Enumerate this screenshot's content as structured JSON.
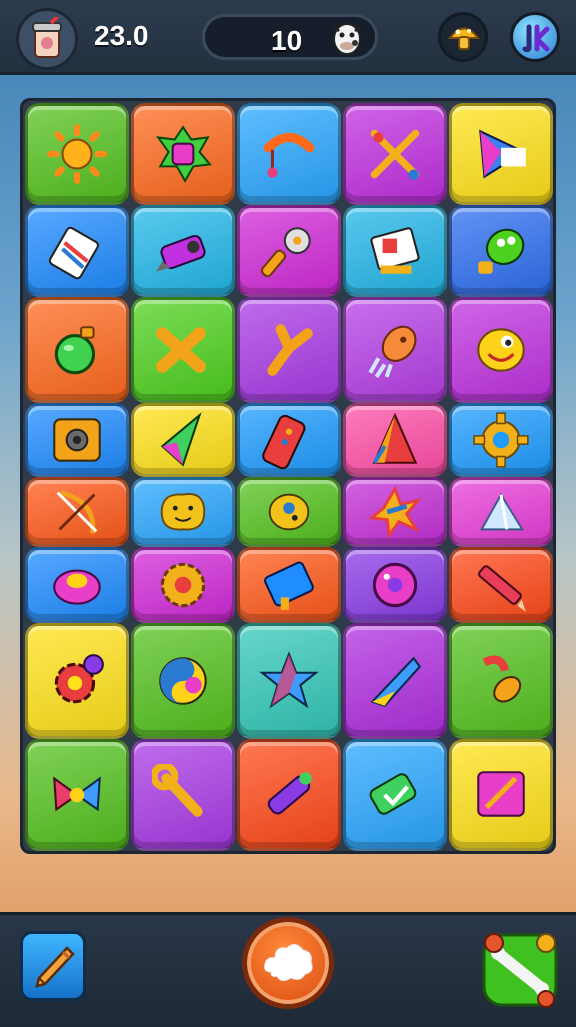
{
  "hud": {
    "score": "23.0",
    "counter": "10",
    "icons": [
      "cup-icon",
      "cow-icon",
      "mushroom-icon",
      "avatar-icon"
    ]
  },
  "board": {
    "rows": 8,
    "cols": 5,
    "tiles": [
      {
        "color": "#55c21f",
        "icon": "sun-icon"
      },
      {
        "color": "#ff6a1f",
        "icon": "flower-gem-icon"
      },
      {
        "color": "#2aa7ff",
        "icon": "hook-icon"
      },
      {
        "color": "#c02fe0",
        "icon": "crossed-swords-icon"
      },
      {
        "color": "#ffe21a",
        "icon": "play-triangle-icon"
      },
      {
        "color": "#1f8cff",
        "icon": "tablet-icon"
      },
      {
        "color": "#22b8e8",
        "icon": "flashlight-icon"
      },
      {
        "color": "#d12ad8",
        "icon": "pizza-cutter-icon"
      },
      {
        "color": "#23b6e8",
        "icon": "book-icon"
      },
      {
        "color": "#2f6ff0",
        "icon": "green-monster-icon"
      },
      {
        "color": "#ff6a1f",
        "icon": "bomb-icon"
      },
      {
        "color": "#4fd11f",
        "icon": "bone-cross-icon"
      },
      {
        "color": "#a93be6",
        "icon": "wrench-y-icon"
      },
      {
        "color": "#b63fe6",
        "icon": "rocket-icon"
      },
      {
        "color": "#c032e0",
        "icon": "smiley-blob-icon"
      },
      {
        "color": "#1f8cff",
        "icon": "speaker-icon"
      },
      {
        "color": "#ffe21a",
        "icon": "crystal-icon"
      },
      {
        "color": "#1f9cff",
        "icon": "remote-icon"
      },
      {
        "color": "#ff4fa8",
        "icon": "cone-icon"
      },
      {
        "color": "#1f9cff",
        "icon": "gear-icon"
      },
      {
        "color": "#ff5a1a",
        "icon": "bow-icon"
      },
      {
        "color": "#2aa7ff",
        "icon": "happy-blob-icon"
      },
      {
        "color": "#55c21f",
        "icon": "egg-icon"
      },
      {
        "color": "#c42fd8",
        "icon": "splat-icon"
      },
      {
        "color": "#e83ed8",
        "icon": "ice-crystal-icon"
      },
      {
        "color": "#1f8cff",
        "icon": "pink-blob-icon"
      },
      {
        "color": "#d12ad8",
        "icon": "gold-gear-icon"
      },
      {
        "color": "#ff5a1a",
        "icon": "notebook-icon"
      },
      {
        "color": "#8a3be6",
        "icon": "donut-icon"
      },
      {
        "color": "#ff4a1a",
        "icon": "pencil-icon"
      },
      {
        "color": "#ffe21a",
        "icon": "gear-cluster-icon"
      },
      {
        "color": "#55c21f",
        "icon": "yin-yang-icon"
      },
      {
        "color": "#33c8b8",
        "icon": "star-icon"
      },
      {
        "color": "#b02fe0",
        "icon": "boomerang-icon"
      },
      {
        "color": "#55c21f",
        "icon": "seed-icon"
      },
      {
        "color": "#55c21f",
        "icon": "bow-ribbon-icon"
      },
      {
        "color": "#a93be6",
        "icon": "wrench-icon"
      },
      {
        "color": "#ff4a1a",
        "icon": "marker-icon"
      },
      {
        "color": "#2aa7ff",
        "icon": "check-tag-icon"
      },
      {
        "color": "#ffe21a",
        "icon": "pen-board-icon"
      }
    ]
  },
  "bottom": {
    "left_tool": "pencil-tool-icon",
    "center": "cloud-icon",
    "right_powerup": "bone-powerup-icon"
  }
}
